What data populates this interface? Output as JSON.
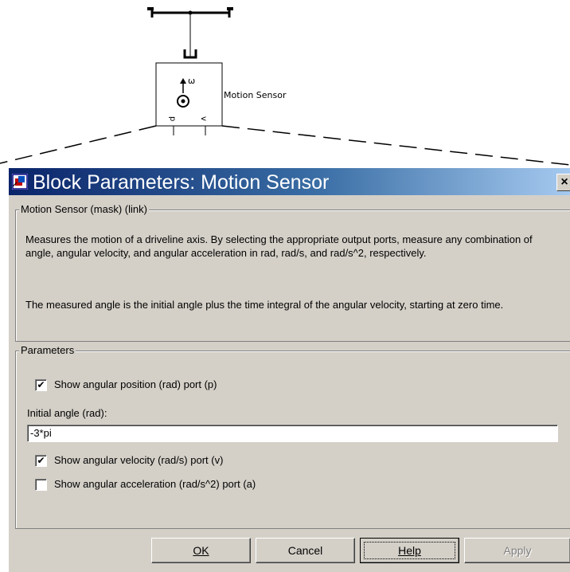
{
  "diagram": {
    "block_label": "Motion Sensor",
    "omega_symbol": "ω",
    "port_p": "p",
    "port_v": "v"
  },
  "dialog": {
    "title": "Block Parameters: Motion Sensor",
    "close_symbol": "×",
    "mask_group_title": "Motion Sensor (mask) (link)",
    "description_1": "Measures the motion of a driveline axis. By selecting the appropriate output ports, measure any combination of angle, angular velocity, and angular acceleration in rad, rad/s, and rad/s^2, respectively.",
    "description_2": "The measured angle is the initial angle plus the time integral of the angular velocity, starting at zero time.",
    "params_group_title": "Parameters",
    "params": {
      "show_position": {
        "label": "Show angular position (rad) port (p)",
        "checked": true
      },
      "initial_angle_label": "Initial angle (rad):",
      "initial_angle_value": "-3*pi",
      "show_velocity": {
        "label": "Show angular velocity (rad/s) port (v)",
        "checked": true
      },
      "show_acceleration": {
        "label": "Show angular acceleration (rad/s^2) port (a)",
        "checked": false
      }
    },
    "buttons": {
      "ok": "OK",
      "cancel": "Cancel",
      "help": "Help",
      "apply": "Apply"
    },
    "check_mark": "✔"
  },
  "colors": {
    "title_gradient_start": "#0a246a",
    "title_gradient_end": "#a6caf0",
    "dialog_face": "#d4d0c8"
  },
  "icons": [
    "simulink-block-icon",
    "close-icon",
    "checkbox-checked",
    "checkbox-unchecked"
  ]
}
